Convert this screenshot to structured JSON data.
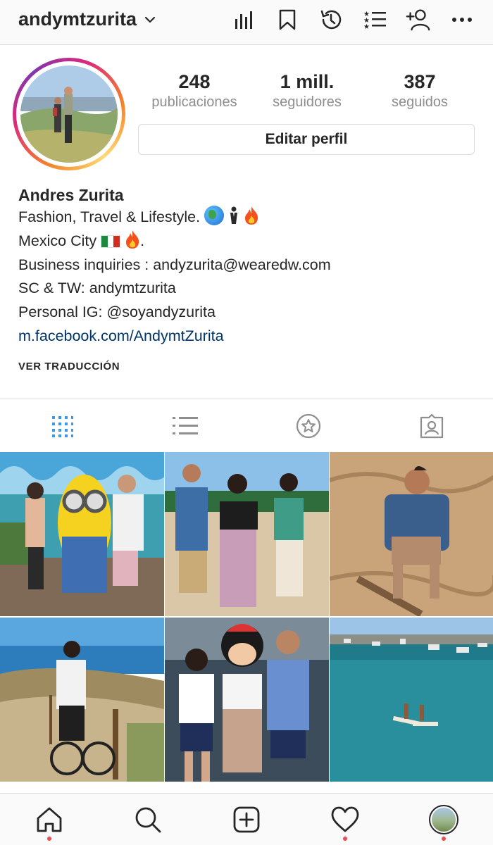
{
  "header": {
    "username": "andymtzurita",
    "icons": [
      "insights-icon",
      "bookmark-icon",
      "archive-icon",
      "close-friends-icon",
      "discover-people-icon",
      "more-icon"
    ]
  },
  "profile": {
    "stats": [
      {
        "value": "248",
        "label": "publicaciones"
      },
      {
        "value": "1 mill.",
        "label": "seguidores"
      },
      {
        "value": "387",
        "label": "seguidos"
      }
    ],
    "edit_label": "Editar perfil"
  },
  "bio": {
    "name": "Andres Zurita",
    "line1": "Fashion, Travel & Lifestyle.",
    "line2_pre": "Mexico City",
    "line2_post": ".",
    "line3": "Business inquiries : andyzurita@wearedw.com",
    "line4": "SC & TW: andymtzurita",
    "line5": "Personal IG: @soyandyzurita",
    "link": "m.facebook.com/AndymtZurita",
    "translate": "VER TRADUCCIÓN"
  },
  "tabs": [
    "grid-icon",
    "list-icon",
    "star-icon",
    "tagged-icon"
  ],
  "colors": {
    "accent": "#3897f0",
    "link": "#003569",
    "muted": "#8e8e8e",
    "border": "#dbdbdb",
    "notification": "#ed4956"
  },
  "bottom_nav": [
    "home-icon",
    "search-icon",
    "new-post-icon",
    "activity-icon",
    "profile-avatar"
  ]
}
